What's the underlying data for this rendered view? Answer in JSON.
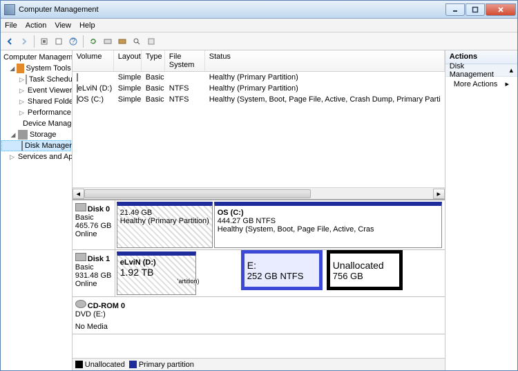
{
  "window": {
    "title": "Computer Management"
  },
  "menu": {
    "file": "File",
    "action": "Action",
    "view": "View",
    "help": "Help"
  },
  "tree": {
    "root": "Computer Management (Local",
    "system_tools": "System Tools",
    "task_scheduler": "Task Scheduler",
    "event_viewer": "Event Viewer",
    "shared_folders": "Shared Folders",
    "performance": "Performance",
    "device_manager": "Device Manager",
    "storage": "Storage",
    "disk_management": "Disk Management",
    "services": "Services and Applications"
  },
  "vol_headers": {
    "volume": "Volume",
    "layout": "Layout",
    "type": "Type",
    "fs": "File System",
    "status": "Status"
  },
  "vol_rows": [
    {
      "volume": "",
      "layout": "Simple",
      "type": "Basic",
      "fs": "",
      "status": "Healthy (Primary Partition)"
    },
    {
      "volume": "eLviN (D:)",
      "layout": "Simple",
      "type": "Basic",
      "fs": "NTFS",
      "status": "Healthy (Primary Partition)"
    },
    {
      "volume": "OS (C:)",
      "layout": "Simple",
      "type": "Basic",
      "fs": "NTFS",
      "status": "Healthy (System, Boot, Page File, Active, Crash Dump, Primary Parti"
    }
  ],
  "disks": {
    "d0": {
      "name": "Disk 0",
      "kind": "Basic",
      "size": "465.76 GB",
      "state": "Online",
      "p1": {
        "size": "21.49 GB",
        "status": "Healthy (Primary Partition)"
      },
      "p2": {
        "label": "OS  (C:)",
        "size": "444.27 GB NTFS",
        "status": "Healthy (System, Boot, Page File, Active, Cras"
      }
    },
    "d1": {
      "name": "Disk 1",
      "kind": "Basic",
      "size": "931.48 GB",
      "state": "Online",
      "p1": {
        "label": "eLviN (D:)",
        "size": "1.92 TB",
        "tail": "'artition)"
      },
      "ov1": {
        "label": "E:",
        "size": "252 GB NTFS"
      },
      "ov2": {
        "label": "Unallocated",
        "size": "756 GB"
      }
    },
    "cd": {
      "name": "CD-ROM 0",
      "kind": "DVD (E:)",
      "state": "No Media"
    }
  },
  "legend": {
    "unalloc": "Unallocated",
    "primary": "Primary partition"
  },
  "actions": {
    "header": "Actions",
    "section": "Disk Management",
    "more": "More Actions"
  }
}
